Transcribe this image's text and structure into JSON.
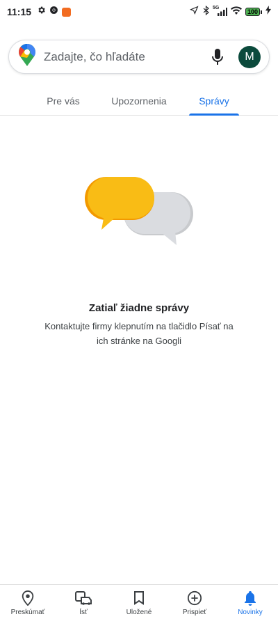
{
  "status_bar": {
    "time": "11:15",
    "network": "5G",
    "battery": "100"
  },
  "search": {
    "placeholder": "Zadajte, čo hľadáte",
    "avatar_initial": "M"
  },
  "tabs": [
    {
      "label": "Pre vás",
      "active": false
    },
    {
      "label": "Upozornenia",
      "active": false
    },
    {
      "label": "Správy",
      "active": true
    }
  ],
  "empty_state": {
    "title": "Zatiaľ žiadne správy",
    "description": "Kontaktujte firmy klepnutím na tlačidlo Písať na ich stránke na Googli"
  },
  "bottom_nav": [
    {
      "label": "Preskúmať",
      "icon": "location-pin-icon",
      "active": false
    },
    {
      "label": "Ísť",
      "icon": "commute-icon",
      "active": false
    },
    {
      "label": "Uložené",
      "icon": "bookmark-icon",
      "active": false
    },
    {
      "label": "Prispieť",
      "icon": "add-circle-icon",
      "active": false
    },
    {
      "label": "Novinky",
      "icon": "bell-icon",
      "active": true
    }
  ],
  "colors": {
    "accent": "#1a73e8",
    "bubble_yellow": "#f9bc15",
    "bubble_gray": "#dadce0",
    "avatar_bg": "#0b4a3c"
  }
}
